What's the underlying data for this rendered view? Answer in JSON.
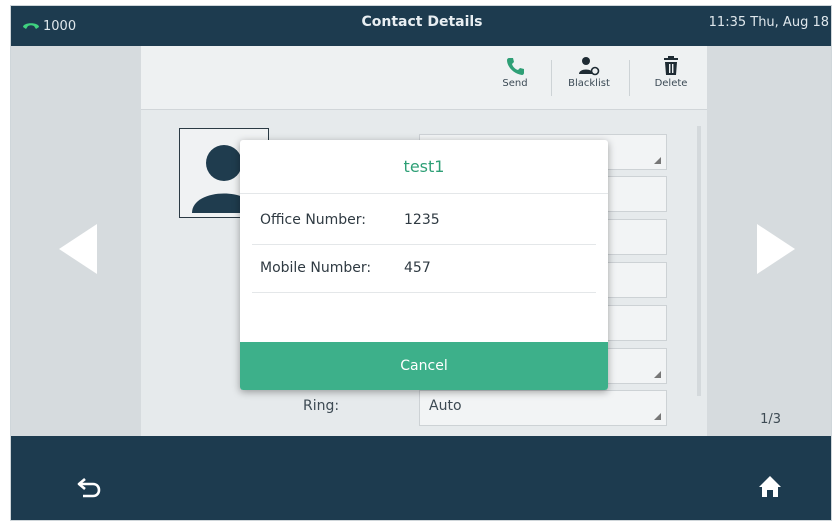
{
  "status_bar": {
    "account": "1000",
    "title": "Contact Details",
    "clock": "11:35 Thu, Aug 18"
  },
  "toolbar": {
    "send_label": "Send",
    "blacklist_label": "Blacklist",
    "delete_label": "Delete"
  },
  "form": {
    "ring_label": "Ring:",
    "ring_value": "Auto"
  },
  "pager": {
    "indicator": "1/3"
  },
  "dialog": {
    "title": "test1",
    "rows": [
      {
        "label": "Office Number:",
        "value": "1235"
      },
      {
        "label": "Mobile Number:",
        "value": "457"
      }
    ],
    "cancel_label": "Cancel"
  },
  "colors": {
    "bar_bg": "#1d3b4f",
    "accent_green": "#3db08a",
    "title_green": "#2e9f76"
  },
  "icons": {
    "account": "phone-handset-icon",
    "send": "phone-call-icon",
    "blacklist": "person-block-icon",
    "delete": "trash-icon",
    "back": "back-arrow-icon",
    "home": "home-icon",
    "prev": "chevron-left-icon",
    "next": "chevron-right-icon",
    "avatar": "person-silhouette-icon"
  }
}
